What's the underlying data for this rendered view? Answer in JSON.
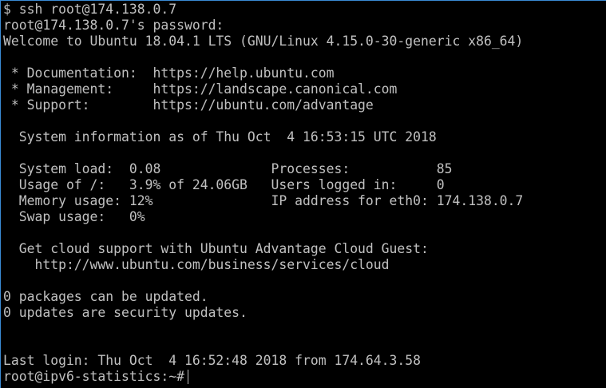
{
  "terminal": {
    "lines": [
      "$ ssh root@174.138.0.7",
      "root@174.138.0.7's password:",
      "Welcome to Ubuntu 18.04.1 LTS (GNU/Linux 4.15.0-30-generic x86_64)",
      "",
      " * Documentation:  https://help.ubuntu.com",
      " * Management:     https://landscape.canonical.com",
      " * Support:        https://ubuntu.com/advantage",
      "",
      "  System information as of Thu Oct  4 16:53:15 UTC 2018",
      "",
      "  System load:  0.08              Processes:           85",
      "  Usage of /:   3.9% of 24.06GB   Users logged in:     0",
      "  Memory usage: 12%               IP address for eth0: 174.138.0.7",
      "  Swap usage:   0%",
      "",
      "  Get cloud support with Ubuntu Advantage Cloud Guest:",
      "    http://www.ubuntu.com/business/services/cloud",
      "",
      "0 packages can be updated.",
      "0 updates are security updates.",
      "",
      "",
      "Last login: Thu Oct  4 16:52:48 2018 from 174.64.3.58"
    ],
    "prompt": "root@ipv6-statistics:~#",
    "text_color": "#c0c0c0",
    "background_color": "#000000"
  }
}
